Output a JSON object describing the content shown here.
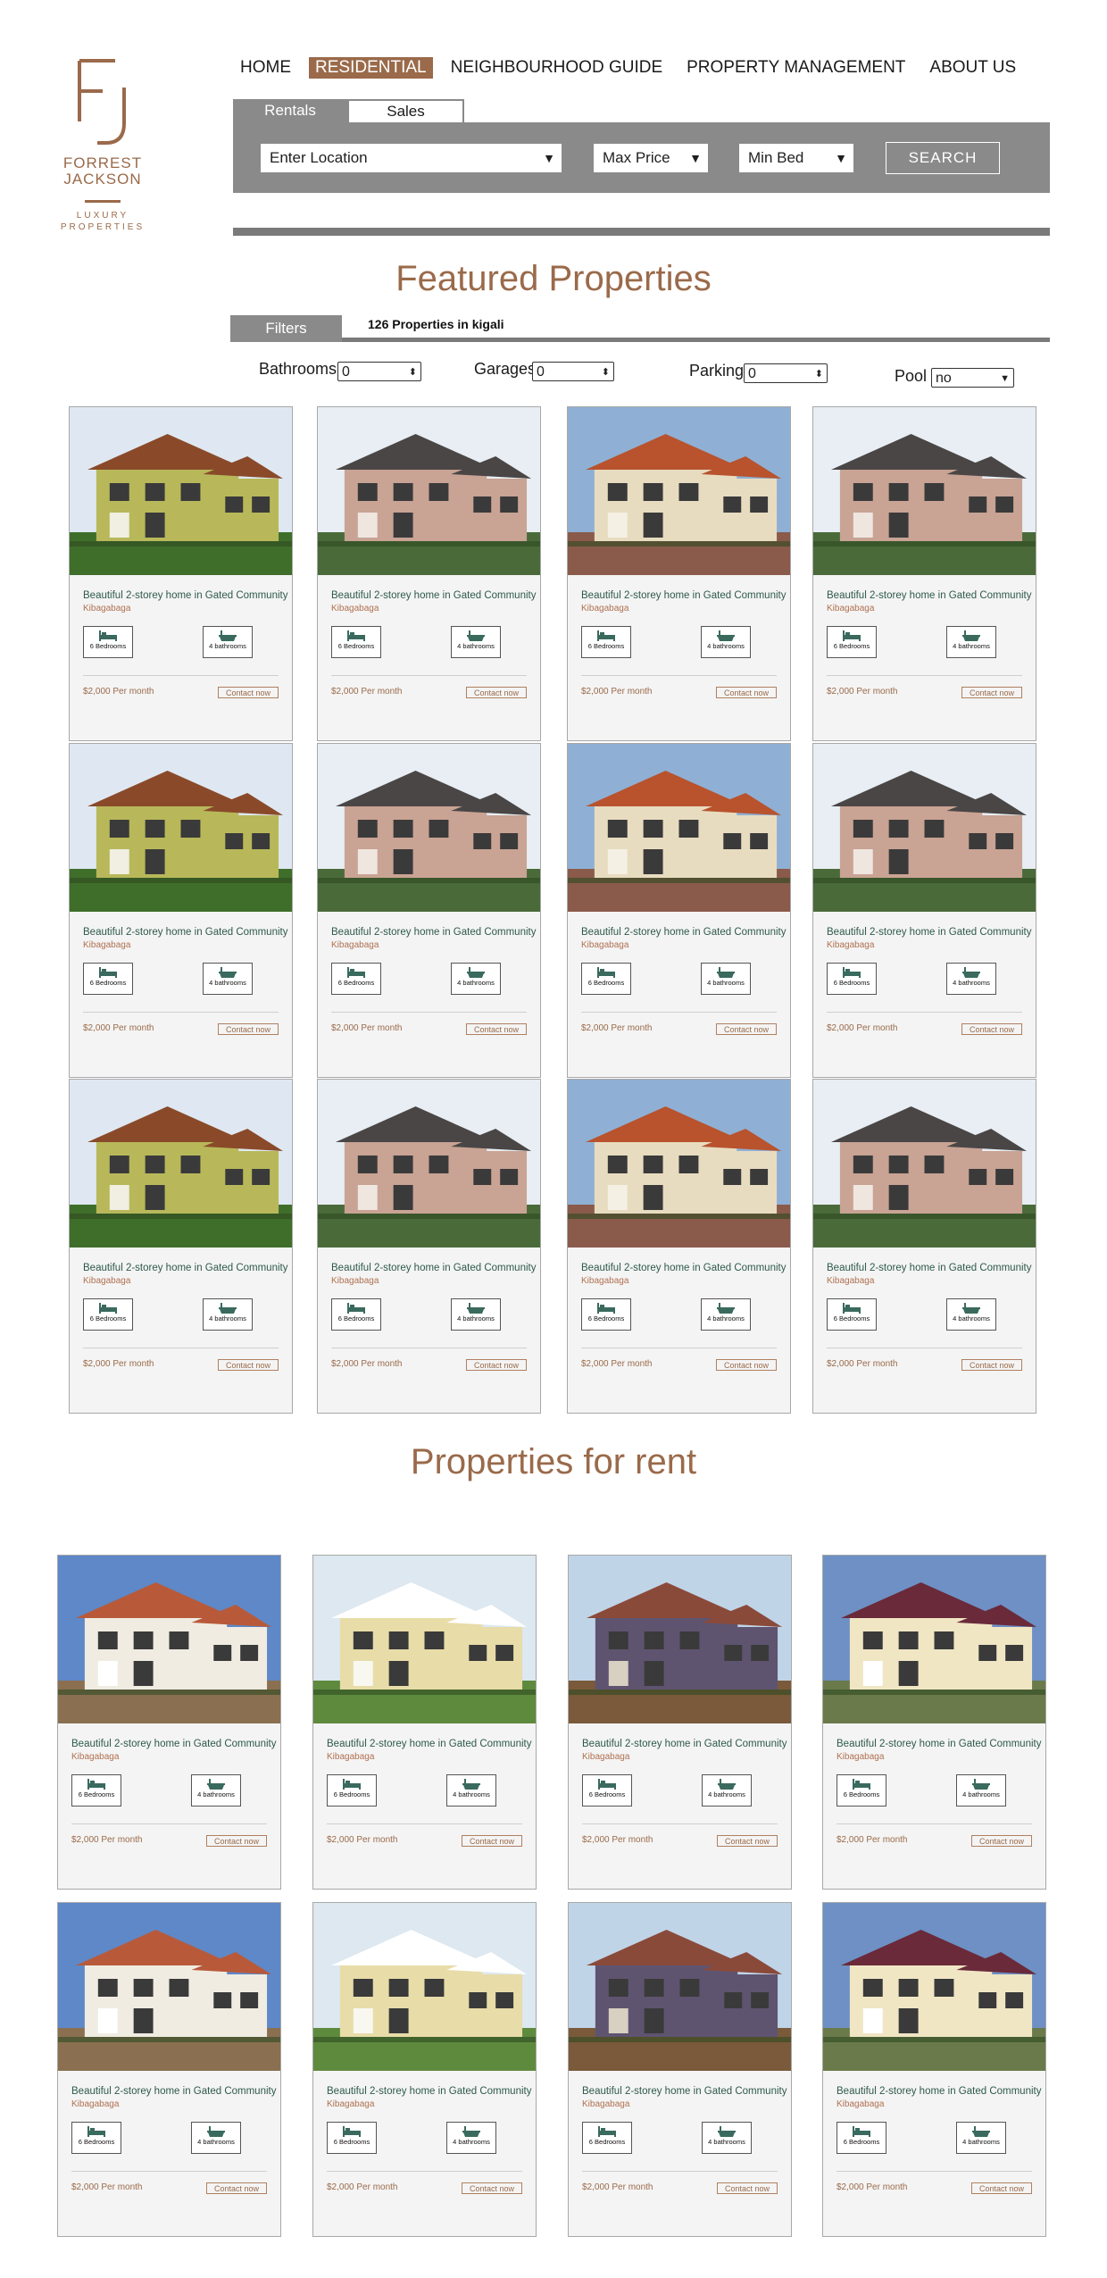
{
  "logo": {
    "initials": "FJ",
    "brand_line1": "FORREST",
    "brand_line2": "JACKSON",
    "tag_line1": "LUXURY",
    "tag_line2": "PROPERTIES"
  },
  "nav": {
    "items": [
      "HOME",
      "RESIDENTIAL",
      "NEIGHBOURHOOD GUIDE",
      "PROPERTY MANAGEMENT",
      "ABOUT US"
    ],
    "active": "RESIDENTIAL"
  },
  "search": {
    "tabs": [
      "Rentals",
      "Sales"
    ],
    "location_placeholder": "Enter Location",
    "max_price": "Max Price",
    "min_bed": "Min Bed",
    "button": "SEARCH"
  },
  "featured": {
    "title": "Featured Properties",
    "filters_tab": "Filters",
    "count_text": "126 Properties in kigali",
    "filters": [
      {
        "label": "Bathrooms",
        "value": "0"
      },
      {
        "label": "Garages",
        "value": "0"
      },
      {
        "label": "Parking",
        "value": "0"
      },
      {
        "label": "Pool",
        "value": "no"
      }
    ]
  },
  "rent": {
    "title": "Properties for rent"
  },
  "card": {
    "title": "Beautiful 2-storey home in Gated Community",
    "location": "Kibagabaga",
    "bedrooms": "6 Bedrooms",
    "bathrooms": "4 bathrooms",
    "price": "$2,000 Per month",
    "contact": "Contact now"
  },
  "colors": {
    "brand": "#9a6a4a",
    "gray_bar": "#8a8a8a",
    "title_green": "#2e5a4a"
  },
  "icons": [
    "bed-icon",
    "bathtub-icon",
    "chevron-down-icon"
  ]
}
